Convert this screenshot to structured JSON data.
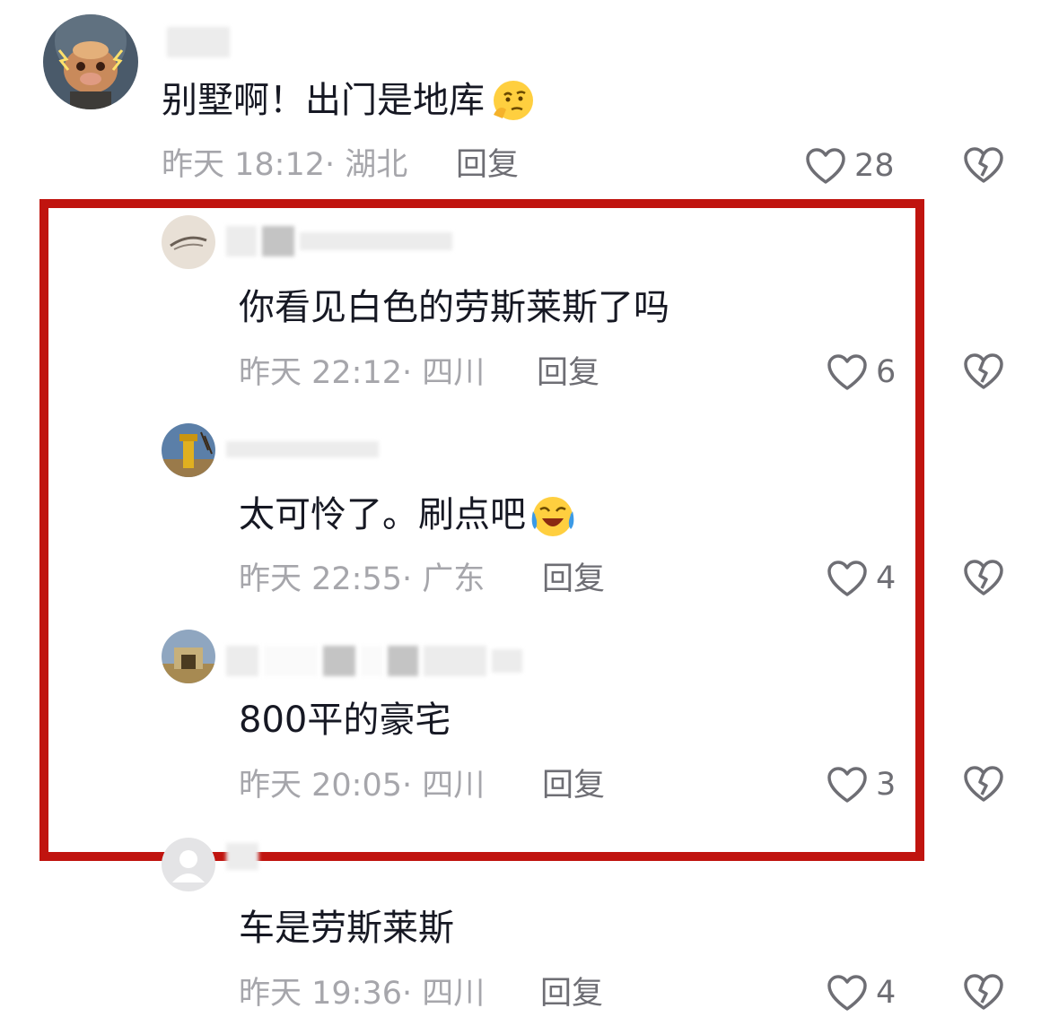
{
  "colors": {
    "highlight_border": "#c0140f",
    "text": "#161823",
    "meta": "#a6a6ab",
    "secondary": "#6e6e74"
  },
  "comments": [
    {
      "text": "别墅啊！出门是地库",
      "emoji": "thinking-emoji",
      "meta": "昨天 18:12· 湖北",
      "reply": "回复",
      "likes": "28"
    },
    {
      "text": "你看见白色的劳斯莱斯了吗",
      "meta": "昨天 22:12· 四川",
      "reply": "回复",
      "likes": "6"
    },
    {
      "text": "太可怜了。刷点吧",
      "emoji": "crying-laughing-emoji",
      "meta": "昨天 22:55· 广东",
      "reply": "回复",
      "likes": "4"
    },
    {
      "text": "800平的豪宅",
      "meta": "昨天 20:05· 四川",
      "reply": "回复",
      "likes": "3"
    },
    {
      "text": "车是劳斯莱斯",
      "meta": "昨天 19:36· 四川",
      "reply": "回复",
      "likes": "4"
    }
  ]
}
